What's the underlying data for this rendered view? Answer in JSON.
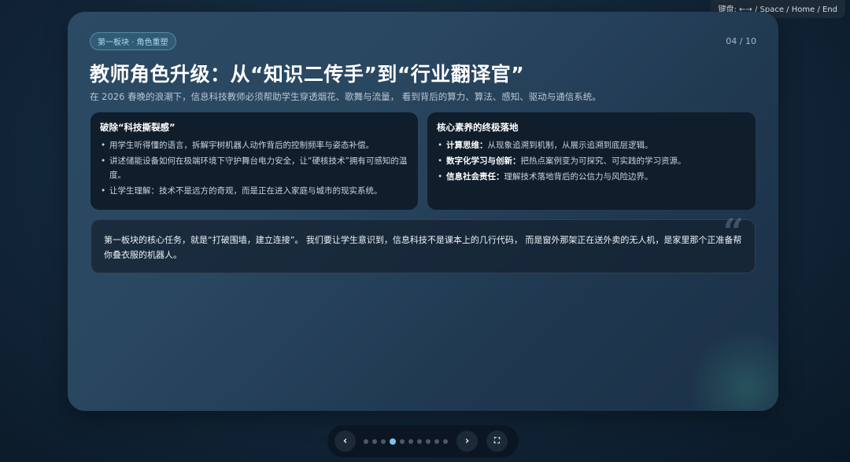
{
  "hint": "键盘: ←→ / Space / Home / End",
  "slide": {
    "badge": "第一板块 · 角色重塑",
    "counter": "04 / 10",
    "title": "教师角色升级：从“知识二传手”到“行业翻译官”",
    "subtitle": "在 2026 春晚的浪潮下，信息科技教师必须帮助学生穿透烟花、歌舞与流量， 看到背后的算力、算法、感知、驱动与通信系统。",
    "cards": [
      {
        "title": "破除“科技撕裂感”",
        "items": [
          "用学生听得懂的语言，拆解宇树机器人动作背后的控制频率与姿态补偿。",
          "讲述储能设备如何在极端环境下守护舞台电力安全，让“硬核技术”拥有可感知的温度。",
          "让学生理解：技术不是远方的奇观，而是正在进入家庭与城市的现实系统。"
        ]
      },
      {
        "title": "核心素养的终极落地",
        "items": [
          {
            "term": "计算思维：",
            "text": "从现象追溯到机制，从展示追溯到底层逻辑。"
          },
          {
            "term": "数字化学习与创新：",
            "text": "把热点案例变为可探究、可实践的学习资源。"
          },
          {
            "term": "信息社会责任：",
            "text": "理解技术落地背后的公信力与风险边界。"
          }
        ]
      }
    ],
    "quote_mark": "“",
    "quote": "第一板块的核心任务，就是“打破围墙，建立连接”。 我们要让学生意识到，信息科技不是课本上的几行代码， 而是窗外那架正在送外卖的无人机，是家里那个正准备帮你叠衣服的机器人。"
  },
  "nav": {
    "prev": "‹",
    "next": "›",
    "fullscreen": "⛶",
    "dot_count": 10,
    "active_index": 3
  },
  "colors": {
    "accent": "#7cc4ec",
    "card_bg": "#101d2b"
  }
}
